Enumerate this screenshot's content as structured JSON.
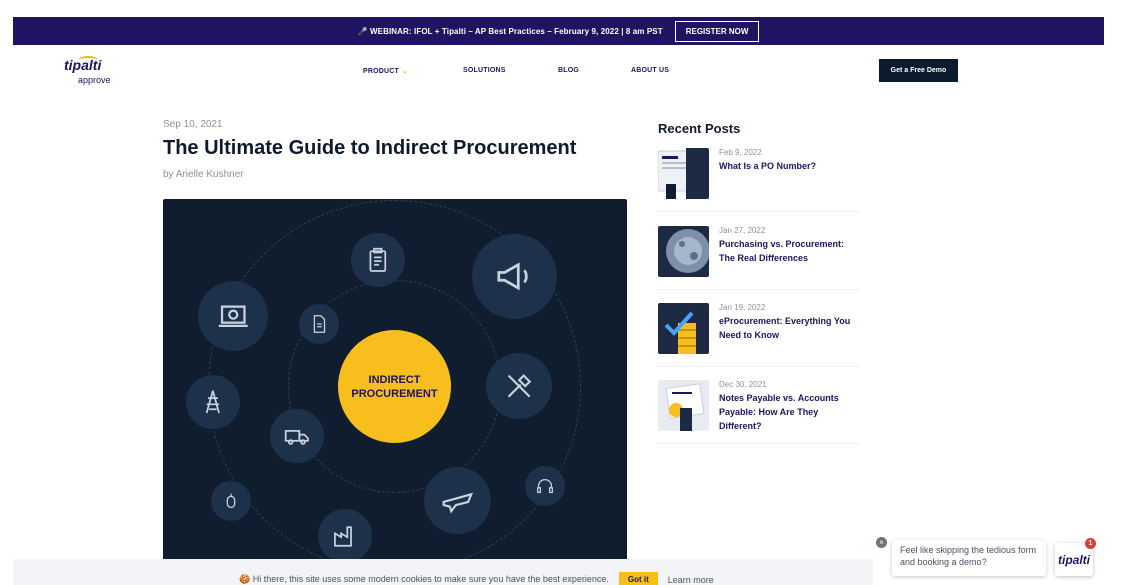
{
  "banner": {
    "text": "🎤 WEBINAR: IFOL + Tipalti – AP Best Practices – February 9, 2022 | 8 am PST",
    "button": "REGISTER NOW"
  },
  "logo": {
    "word": "tipalti",
    "sub": "approve"
  },
  "nav": {
    "items": [
      "PRODUCT",
      "SOLUTIONS",
      "BLOG",
      "ABOUT US"
    ],
    "product_chevron": "⌄",
    "demo_button": "Get a Free Demo"
  },
  "post": {
    "date": "Sep 10, 2021",
    "title": "The Ultimate Guide to Indirect Procurement",
    "author": "by Arielle Kushner",
    "hero_line1": "INDIRECT",
    "hero_line2": "PROCUREMENT"
  },
  "recent": {
    "title": "Recent Posts",
    "items": [
      {
        "date": "Feb 9, 2022",
        "label": "What Is a PO Number?"
      },
      {
        "date": "Jan 27, 2022",
        "label": "Purchasing vs. Procurement: The Real Differences"
      },
      {
        "date": "Jan 19, 2022",
        "label": "eProcurement: Everything You Need to Know"
      },
      {
        "date": "Dec 30, 2021",
        "label": "Notes Payable vs. Accounts Payable: How Are They Different?"
      }
    ]
  },
  "chat": {
    "message": "Feel like skipping the tedious form and booking a demo?",
    "launcher_word": "tipalti",
    "badge": "1",
    "close": "×"
  },
  "cookie": {
    "text": "🍪 Hi there, this site uses some modern cookies to make sure you have the best experience.",
    "button": "Got it",
    "link": "Learn more"
  },
  "colors": {
    "brand": "#1e1461",
    "accent": "#f7be1e",
    "hero_bg": "#0f1d2f"
  }
}
